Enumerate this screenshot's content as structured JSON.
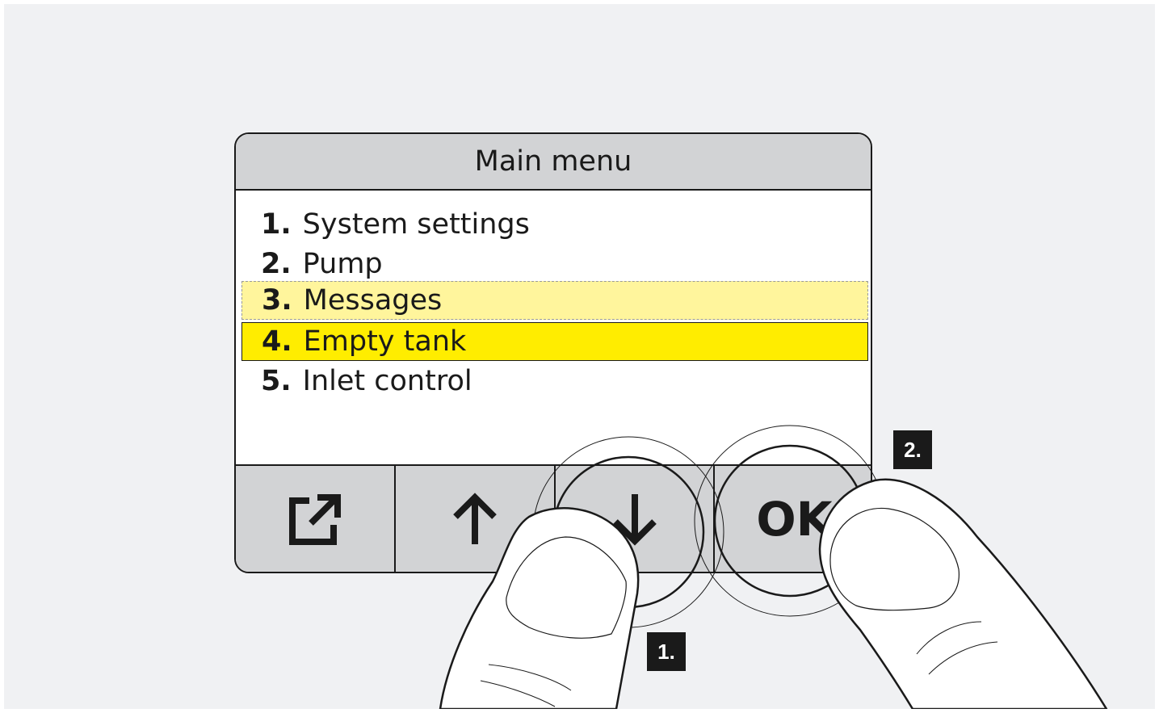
{
  "screen": {
    "title": "Main menu",
    "menu_items": [
      {
        "num": "1.",
        "label": "System settings",
        "state": "normal"
      },
      {
        "num": "2.",
        "label": "Pump",
        "state": "normal"
      },
      {
        "num": "3.",
        "label": "Messages",
        "state": "previous"
      },
      {
        "num": "4.",
        "label": "Empty tank",
        "state": "selected"
      },
      {
        "num": "5.",
        "label": "Inlet control",
        "state": "normal"
      }
    ]
  },
  "softkeys": [
    {
      "icon": "exit-icon"
    },
    {
      "icon": "arrow-up-icon"
    },
    {
      "icon": "arrow-down-icon"
    },
    {
      "label": "OK"
    }
  ],
  "steps": [
    {
      "label": "1.",
      "target": "arrow-down-key"
    },
    {
      "label": "2.",
      "target": "ok-key"
    }
  ],
  "colors": {
    "background": "#f0f1f3",
    "bar": "#d2d3d5",
    "selected": "#ffed00",
    "previous_selected": "#fff59c",
    "ink": "#1a1a1a"
  }
}
